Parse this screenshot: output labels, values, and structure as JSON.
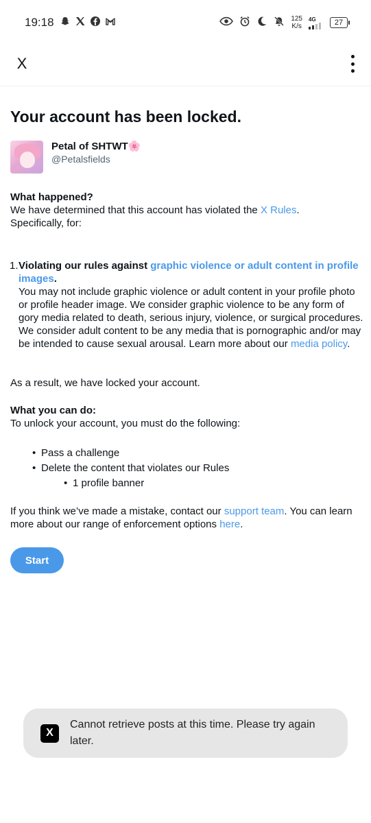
{
  "status_bar": {
    "time": "19:18",
    "notification_icons": [
      "snapchat-icon",
      "x-icon",
      "facebook-icon",
      "gmail-icon"
    ],
    "speed_value": "125",
    "speed_unit": "K/s",
    "network": "4G",
    "battery": "27"
  },
  "app_bar": {
    "close_label": "X",
    "more_icon": "more-vertical-icon"
  },
  "page": {
    "title": "Your account has been locked.",
    "profile": {
      "name": "Petal of SHTWT",
      "name_emoji": "🌸",
      "handle": "@Petalsfields"
    },
    "what_happened": {
      "title": "What happened?",
      "text_before": "We have determined that this account has violated the ",
      "link": "X Rules",
      "text_after": ".",
      "specifically": "Specifically, for:"
    },
    "violations": [
      {
        "number": "1.",
        "heading_prefix": "Violating our rules against ",
        "heading_link": "graphic violence or adult content in profile images",
        "heading_suffix": ".",
        "body": "You may not include graphic violence or adult content in your profile photo or profile header image. We consider graphic violence to be any form of gory media related to death, serious injury, violence, or surgical procedures. We consider adult content to be any media that is pornographic and/or may be intended to cause sexual arousal. Learn more about our ",
        "body_link": "media policy",
        "body_suffix": "."
      }
    ],
    "result_text": "As a result, we have locked your account.",
    "what_you_can_do": {
      "title": "What you can do:",
      "text": "To unlock your account, you must do the following:",
      "steps": [
        "Pass a challenge",
        "Delete the content that violates our Rules"
      ],
      "sub_steps": [
        "1 profile banner"
      ]
    },
    "mistake": {
      "text_before": "If you think we’ve made a mistake, contact our ",
      "support_link": "support team",
      "text_middle": ". You can learn more about our range of enforcement options ",
      "here_link": "here",
      "text_after": "."
    },
    "start_button": "Start"
  },
  "toast": {
    "logo": "X",
    "message": "Cannot retrieve posts at this time. Please try again later."
  },
  "colors": {
    "link": "#4a99e9",
    "button": "#4a99e9",
    "toast_bg": "#e6e6e6",
    "text": "#0f1419"
  }
}
